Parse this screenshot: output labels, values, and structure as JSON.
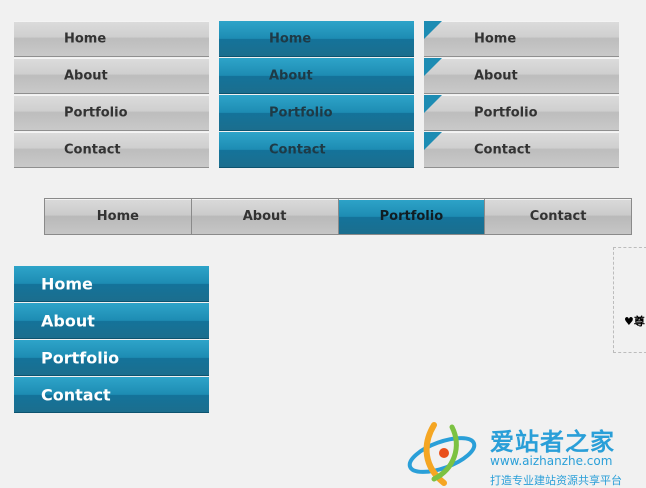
{
  "menus": {
    "menu1": [
      "Home",
      "About",
      "Portfolio",
      "Contact"
    ],
    "menu2": [
      "Home",
      "About",
      "Portfolio",
      "Contact"
    ],
    "menu3": [
      "Home",
      "About",
      "Portfolio",
      "Contact"
    ],
    "horizontal": [
      "Home",
      "About",
      "Portfolio",
      "Contact"
    ],
    "horizontal_active": "Portfolio",
    "menu4": [
      "Home",
      "About",
      "Portfolio",
      "Contact"
    ]
  },
  "sidebox": {
    "text": "♥尊"
  },
  "watermark": {
    "title": "爱站者之家",
    "url": "www.aizhanzhe.com",
    "subtitle": "打造专业建站资源共享平台"
  },
  "colors": {
    "accent_blue": "#1d8cb3",
    "gray_bar": "#cfcfcf",
    "watermark_blue": "#2a9fd8"
  }
}
